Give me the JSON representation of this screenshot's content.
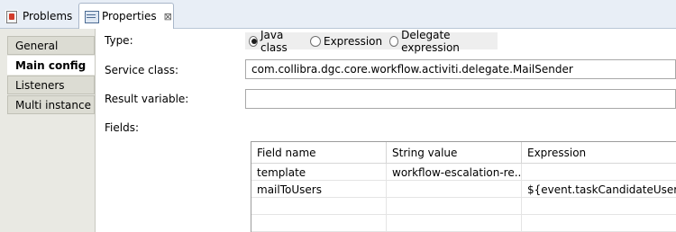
{
  "tabs": [
    {
      "label": "Problems",
      "icon": "problems-icon"
    },
    {
      "label": "Properties",
      "icon": "properties-icon",
      "close": "⊠"
    }
  ],
  "nav": [
    {
      "label": "General"
    },
    {
      "label": "Main config"
    },
    {
      "label": "Listeners"
    },
    {
      "label": "Multi instance"
    }
  ],
  "form": {
    "type_label": "Type:",
    "type_options": [
      "Java class",
      "Expression",
      "Delegate expression"
    ],
    "type_selected": "Java class",
    "service_class_label": "Service class:",
    "service_class_value": "com.collibra.dgc.core.workflow.activiti.delegate.MailSender",
    "result_variable_label": "Result variable:",
    "result_variable_value": "",
    "fields_label": "Fields:"
  },
  "table": {
    "headers": [
      "Field name",
      "String value",
      "Expression"
    ],
    "rows": [
      [
        "template",
        "workflow-escalation-re...",
        ""
      ],
      [
        "mailToUsers",
        "",
        "${event.taskCandidateUsers}"
      ],
      [
        "",
        "",
        ""
      ],
      [
        "",
        "",
        ""
      ]
    ]
  }
}
